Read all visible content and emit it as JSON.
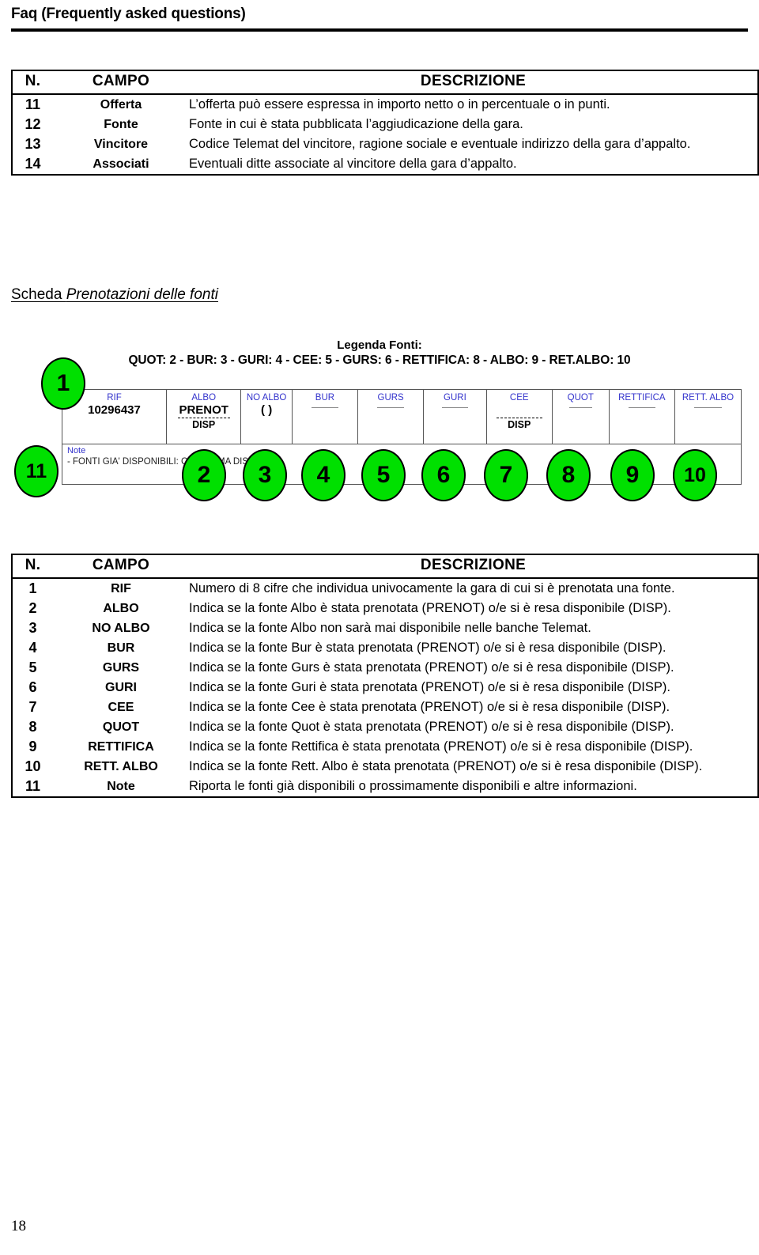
{
  "header": {
    "title": "Faq (Frequently asked questions)"
  },
  "table_top": {
    "columns": [
      "N.",
      "CAMPO",
      "DESCRIZIONE"
    ],
    "rows": [
      {
        "n": "11",
        "campo": "Offerta",
        "desc": "L’offerta può essere espressa in importo netto o in percentuale o in punti."
      },
      {
        "n": "12",
        "campo": "Fonte",
        "desc": "Fonte in cui è stata pubblicata l’aggiudicazione della gara."
      },
      {
        "n": "13",
        "campo": "Vincitore",
        "desc": "Codice Telemat del vincitore, ragione sociale e eventuale indirizzo della gara d’appalto."
      },
      {
        "n": "14",
        "campo": "Associati",
        "desc": "Eventuali ditte associate al vincitore della gara d’appalto."
      }
    ]
  },
  "section": {
    "prefix": "Scheda ",
    "italic": "Prenotazioni delle fonti"
  },
  "figure": {
    "legend_title": "Legenda Fonti:",
    "legend_line": "QUOT: 2 - BUR: 3 - GURI: 4 - CEE: 5 - GURS: 6 - RETTIFICA: 8 - ALBO: 9 - RET.ALBO: 10",
    "screen_columns": [
      {
        "label": "RIF",
        "value": "10296437",
        "sub": "",
        "dashed": false,
        "blank": false
      },
      {
        "label": "ALBO",
        "value": "PRENOT",
        "sub": "DISP",
        "dashed": true,
        "blank": false
      },
      {
        "label": "NO ALBO",
        "value": "( )",
        "sub": "",
        "dashed": false,
        "blank": false
      },
      {
        "label": "BUR",
        "value": "",
        "sub": "",
        "dashed": false,
        "blank": true
      },
      {
        "label": "GURS",
        "value": "",
        "sub": "",
        "dashed": false,
        "blank": true
      },
      {
        "label": "GURI",
        "value": "",
        "sub": "",
        "dashed": false,
        "blank": true
      },
      {
        "label": "CEE",
        "value": "",
        "sub": "DISP",
        "dashed": true,
        "blank": false
      },
      {
        "label": "QUOT",
        "value": "",
        "sub": "",
        "dashed": false,
        "blank": true
      },
      {
        "label": "RETTIFICA",
        "value": "",
        "sub": "",
        "dashed": false,
        "blank": true
      },
      {
        "label": "RETT. ALBO",
        "value": "",
        "sub": "",
        "dashed": false,
        "blank": true
      }
    ],
    "note_title": "Note",
    "note_text": "- FONTI GIA' DISPONIBILI: CEE PRIMA DISP ALBO",
    "callouts": [
      "1",
      "2",
      "3",
      "4",
      "5",
      "6",
      "7",
      "8",
      "9",
      "10",
      "11"
    ],
    "callout_color": "#00E000"
  },
  "table_bottom": {
    "columns": [
      "N.",
      "CAMPO",
      "DESCRIZIONE"
    ],
    "rows": [
      {
        "n": "1",
        "campo": "RIF",
        "desc": "Numero di 8 cifre che individua univocamente la gara di cui si è prenotata una fonte."
      },
      {
        "n": "2",
        "campo": "ALBO",
        "desc": "Indica se la fonte Albo è stata prenotata (PRENOT) o/e si è resa disponibile (DISP)."
      },
      {
        "n": "3",
        "campo": "NO ALBO",
        "desc": "Indica se la fonte Albo non sarà mai disponibile nelle banche Telemat."
      },
      {
        "n": "4",
        "campo": "BUR",
        "desc": "Indica se la fonte Bur è stata prenotata (PRENOT) o/e si è resa disponibile (DISP)."
      },
      {
        "n": "5",
        "campo": "GURS",
        "desc": "Indica se la fonte Gurs è stata prenotata (PRENOT) o/e si è resa disponibile (DISP)."
      },
      {
        "n": "6",
        "campo": "GURI",
        "desc": "Indica se la fonte Guri è stata prenotata (PRENOT) o/e si è resa disponibile (DISP)."
      },
      {
        "n": "7",
        "campo": "CEE",
        "desc": "Indica se la fonte Cee è stata prenotata (PRENOT) o/e si è resa disponibile (DISP)."
      },
      {
        "n": "8",
        "campo": "QUOT",
        "desc": "Indica se la fonte Quot è stata prenotata (PRENOT) o/e si è resa disponibile (DISP)."
      },
      {
        "n": "9",
        "campo": "RETTIFICA",
        "desc": "Indica se la fonte Rettifica è stata prenotata (PRENOT) o/e si è resa disponibile (DISP)."
      },
      {
        "n": "10",
        "campo": "RETT. ALBO",
        "desc": "Indica se la fonte Rett. Albo è stata prenotata (PRENOT) o/e si è resa disponibile (DISP)."
      },
      {
        "n": "11",
        "campo": "Note",
        "desc": "Riporta le fonti già disponibili o prossimamente disponibili e altre informazioni."
      }
    ]
  },
  "footer": {
    "page_number": "18"
  }
}
